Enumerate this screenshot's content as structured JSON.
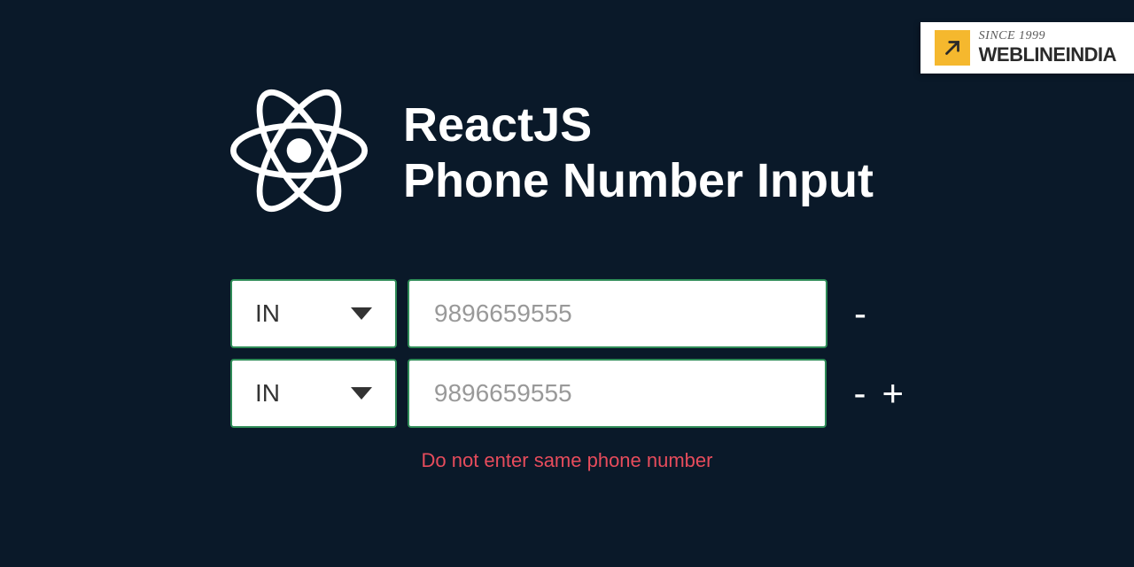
{
  "logo": {
    "since": "SINCE 1999",
    "brand": "WEBLINEINDIA"
  },
  "header": {
    "line1": "ReactJS",
    "line2": "Phone Number Input"
  },
  "rows": [
    {
      "country": "IN",
      "placeholder": "9896659555",
      "controls": {
        "remove": "-",
        "add": ""
      }
    },
    {
      "country": "IN",
      "placeholder": "9896659555",
      "controls": {
        "remove": "-",
        "add": "+"
      }
    }
  ],
  "error": "Do not enter same phone number"
}
